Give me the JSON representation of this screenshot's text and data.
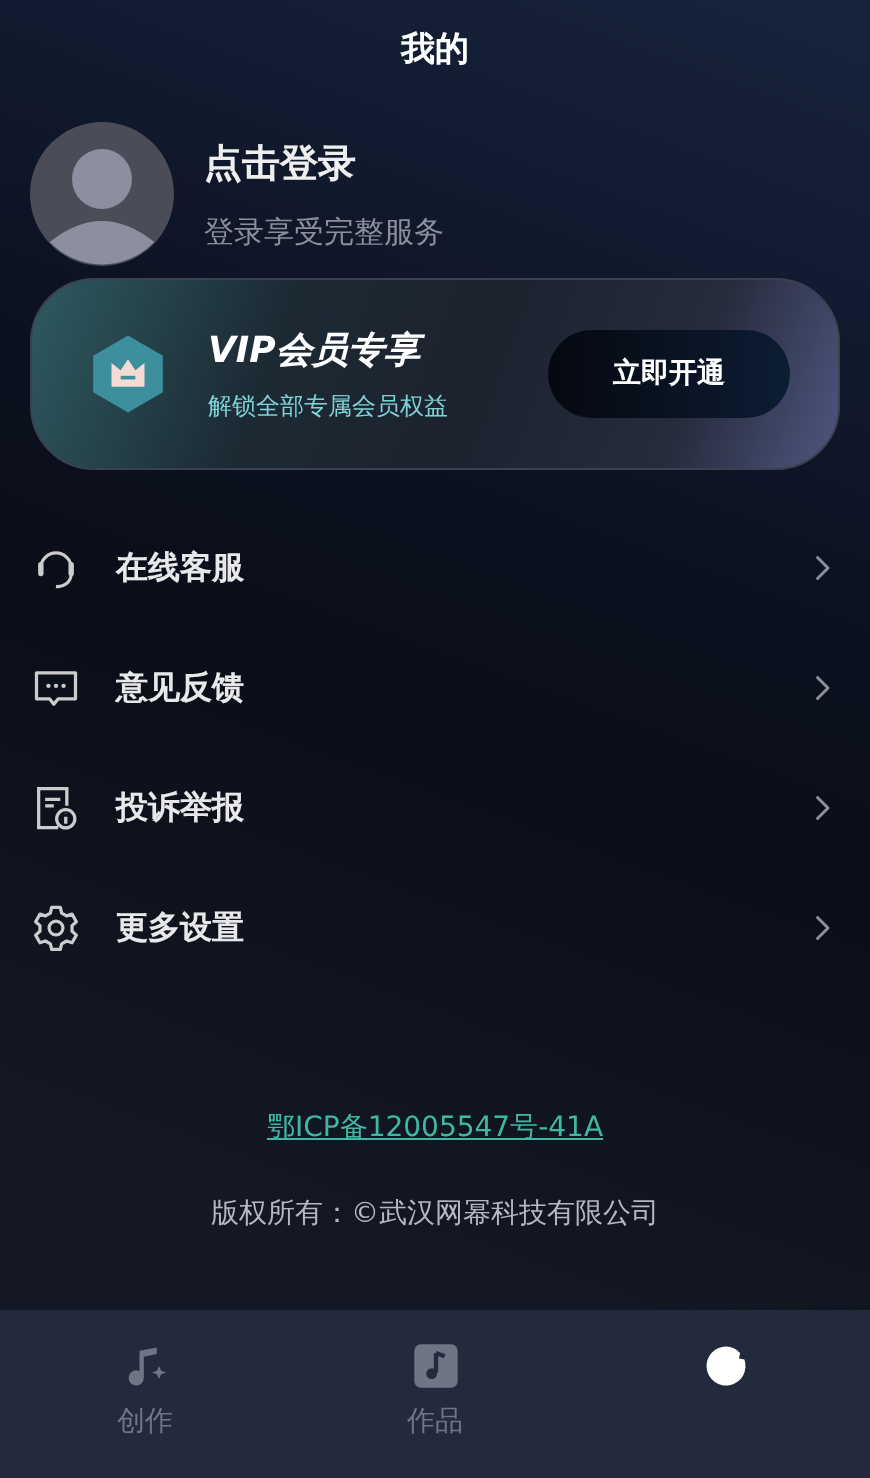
{
  "header": {
    "title": "我的"
  },
  "profile": {
    "name": "点击登录",
    "subtitle": "登录享受完整服务"
  },
  "vip": {
    "title": "VIP会员专享",
    "subtitle": "解锁全部专属会员权益",
    "button": "立即开通"
  },
  "menu": [
    {
      "label": "在线客服"
    },
    {
      "label": "意见反馈"
    },
    {
      "label": "投诉举报"
    },
    {
      "label": "更多设置"
    }
  ],
  "footer": {
    "icp_link": "鄂ICP备12005547号-41A",
    "copyright": "版权所有：©武汉网幂科技有限公司"
  },
  "bottom_nav": [
    {
      "label": "创作",
      "selected": false
    },
    {
      "label": "作品",
      "selected": false
    },
    {
      "selected": true
    }
  ]
}
